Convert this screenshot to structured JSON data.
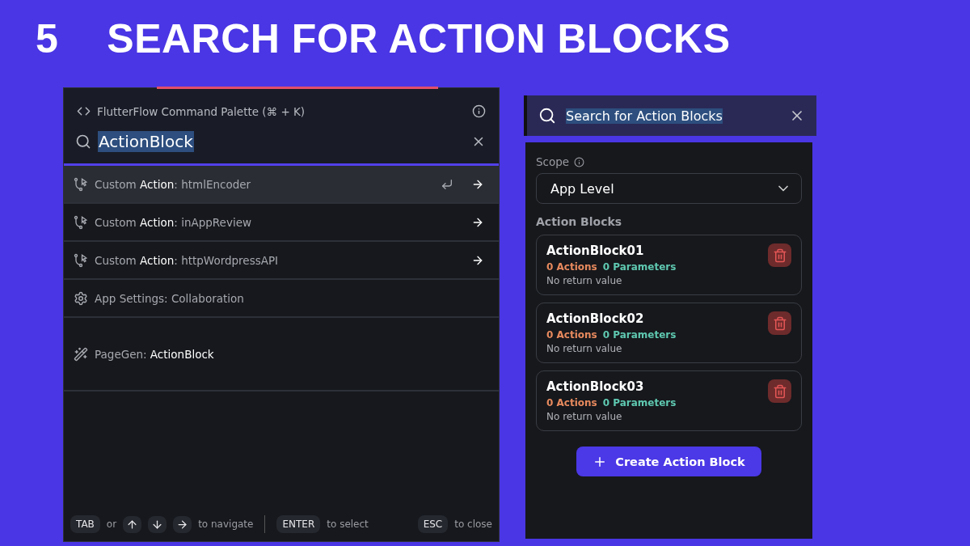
{
  "heading": {
    "step": "5",
    "title": "SEARCH FOR ACTION BLOCKS"
  },
  "palette": {
    "title": "FlutterFlow Command Palette (⌘ + K)",
    "query": "ActionBlock",
    "results": [
      {
        "kind": "action",
        "label": "Custom **Action**: htmlEncoder",
        "selected": true,
        "arrow": true
      },
      {
        "kind": "action",
        "label": "Custom **Action**: inAppReview",
        "selected": false,
        "arrow": true
      },
      {
        "kind": "action",
        "label": "Custom **Action**: httpWordpressAPI",
        "selected": false,
        "arrow": true
      },
      {
        "kind": "settings",
        "label": "App Settings: Collaboration",
        "selected": false,
        "arrow": false
      },
      {
        "kind": "pagegen",
        "label": "PageGen: **ActionBlock**",
        "selected": false,
        "arrow": false
      }
    ],
    "footer": [
      {
        "kind": "key",
        "text": "TAB"
      },
      {
        "kind": "text",
        "text": "or"
      },
      {
        "kind": "up"
      },
      {
        "kind": "down"
      },
      {
        "kind": "right"
      },
      {
        "kind": "text",
        "text": "to navigate"
      },
      {
        "kind": "divider"
      },
      {
        "kind": "key",
        "text": "ENTER"
      },
      {
        "kind": "text",
        "text": "to select"
      },
      {
        "kind": "spacer"
      },
      {
        "kind": "key",
        "text": "ESC"
      },
      {
        "kind": "text",
        "text": "to close"
      }
    ]
  },
  "action_blocks": {
    "search": "Search for Action Blocks",
    "scope_label": "Scope",
    "scope": "App Level",
    "section": "Action Blocks",
    "blocks": [
      {
        "name": "ActionBlock01",
        "actions": "0 Actions",
        "parameters": "0 Parameters",
        "return": "No return value"
      },
      {
        "name": "ActionBlock02",
        "actions": "0 Actions",
        "parameters": "0 Parameters",
        "return": "No return value"
      },
      {
        "name": "ActionBlock03",
        "actions": "0 Actions",
        "parameters": "0 Parameters",
        "return": "No return value"
      }
    ],
    "create_button": "Create Action Block"
  }
}
